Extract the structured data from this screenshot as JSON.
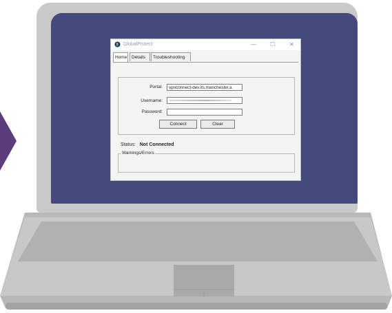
{
  "colors": {
    "screen": "#444a7b",
    "laptop_body": "#c9c9c9",
    "arrow": "#5a3d7a"
  },
  "window": {
    "title": "GlobalProtect",
    "controls": {
      "minimize": "—",
      "maximize": "☐",
      "close": "✕"
    },
    "tabs": [
      {
        "label": "Home"
      },
      {
        "label": "Details"
      },
      {
        "label": "Troubleshooting"
      }
    ],
    "form": {
      "portal_label": "Portal:",
      "portal_value": "vpnconnect-dev.its.manchester.a",
      "username_label": "Username:",
      "password_label": "Password:",
      "connect_label": "Connect",
      "clear_label": "Clear"
    },
    "status_label": "Status:",
    "status_value": "Not Connected",
    "warnings_label": "Warnings/Errors"
  }
}
